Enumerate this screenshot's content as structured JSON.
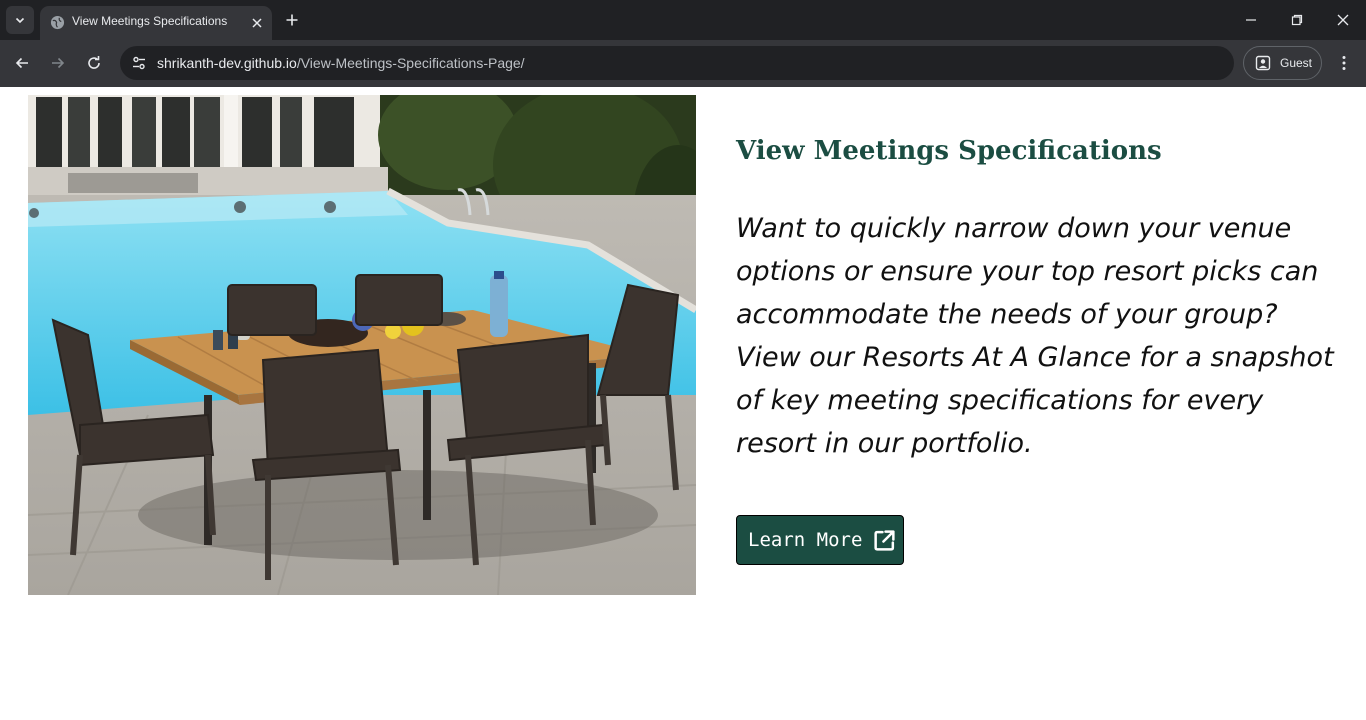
{
  "browser": {
    "tab_title": "View Meetings Specifications",
    "url_host": "shrikanth-dev.github.io",
    "url_path": "/View-Meetings-Specifications-Page/",
    "profile_label": "Guest"
  },
  "page": {
    "heading": "View Meetings Specifications",
    "description": "Want to quickly narrow down your venue options or ensure your top resort picks can accommodate the needs of your group? View our Resorts At A Glance for a snapshot of key meeting specifications for every resort in our portfolio.",
    "button_label": "Learn More",
    "button_icon": "external-link-icon"
  },
  "colors": {
    "brand_green": "#1b4d42",
    "chrome_dark": "#202124",
    "chrome_toolbar": "#35363a"
  }
}
